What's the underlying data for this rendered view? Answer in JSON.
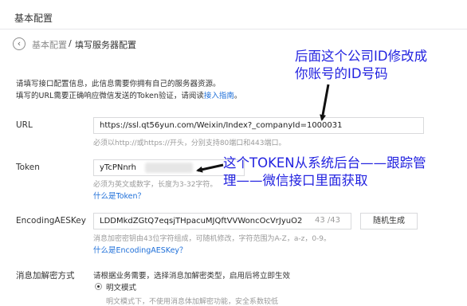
{
  "header": {
    "title": "基本配置"
  },
  "breadcrumb": {
    "back": "基本配置",
    "separator": "/",
    "current": "填写服务器配置"
  },
  "intro": {
    "line1": "请填写接口配置信息，此信息需要你拥有自己的服务器资源。",
    "line2_prefix": "填写的URL需要正确响应微信发送的Token验证，请阅读",
    "line2_link": "接入指南",
    "line2_suffix": "。"
  },
  "url": {
    "label": "URL",
    "value": "https://ssl.qt56yun.com/Weixin/Index?_companyId=1000031",
    "hint": "必须以http://或https://开头，分别支持80端口和443端口。"
  },
  "token": {
    "label": "Token",
    "value": "yTcPNnrh",
    "hint": "必须为英文或数字，长度为3-32字符。",
    "help_link": "什么是Token？"
  },
  "aes": {
    "label": "EncodingAESKey",
    "value": "LDDMkdZGtQ7eqsjTHpacuMJQftVVWoncOcVrJyuO2",
    "counter": "43 /43",
    "button": "随机生成",
    "hint": "消息加密密钥由43位字符组成，可随机修改，字符范围为A-Z，a-z，0-9。",
    "help_link": "什么是EncodingAESKey？"
  },
  "encryption": {
    "label": "消息加解密方式",
    "desc": "请根据业务需要，选择消息加解密类型，启用后将立即生效",
    "option1": "明文模式",
    "option1_desc": "明文模式下，不使用消息体加解密功能，安全系数较低"
  },
  "annotations": {
    "top_line1": "后面这个公司ID修改成",
    "top_line2": "你账号的ID号码",
    "mid_line1": "这个TOKEN从系统后台——跟踪管",
    "mid_line2": "理——微信接口里面获取"
  },
  "colors": {
    "link": "#1e6fd9",
    "annotation": "#2323e0",
    "border": "#d9dadc",
    "hint": "#9a9a9a"
  }
}
